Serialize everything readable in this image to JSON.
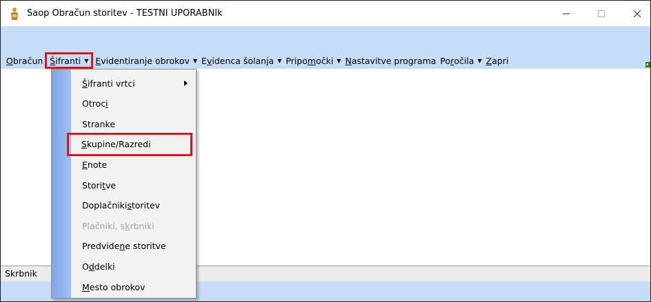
{
  "window": {
    "title": "Saop Obračun storitev - TESTNI UPORABNIk"
  },
  "menubar": {
    "items": [
      {
        "pre": "",
        "ul": "O",
        "post": "bračun",
        "caret": false,
        "active": false
      },
      {
        "pre": "",
        "ul": "Š",
        "post": "ifranti",
        "caret": true,
        "active": true
      },
      {
        "pre": "",
        "ul": "E",
        "post": "videntiranje obrokov",
        "caret": true,
        "active": false
      },
      {
        "pre": "E",
        "ul": "v",
        "post": "idenca šolanja",
        "caret": true,
        "active": false
      },
      {
        "pre": "Pripo",
        "ul": "m",
        "post": "očki",
        "caret": true,
        "active": false
      },
      {
        "pre": "",
        "ul": "N",
        "post": "astavitve programa",
        "caret": false,
        "active": false
      },
      {
        "pre": "Po",
        "ul": "r",
        "post": "očila",
        "caret": true,
        "active": false
      },
      {
        "pre": "",
        "ul": "Z",
        "post": "apri",
        "caret": false,
        "active": false
      }
    ]
  },
  "dropdown": {
    "items": [
      {
        "pre": "",
        "ul": "Š",
        "post": "ifranti vrtci",
        "submenu": true,
        "disabled": false,
        "highlight": false
      },
      {
        "pre": "Otroc",
        "ul": "i",
        "post": "",
        "submenu": false,
        "disabled": false,
        "highlight": false
      },
      {
        "pre": "Stranke",
        "ul": "",
        "post": "",
        "submenu": false,
        "disabled": false,
        "highlight": false
      },
      {
        "pre": "",
        "ul": "S",
        "post": "kupine/Razredi",
        "submenu": false,
        "disabled": false,
        "highlight": true
      },
      {
        "pre": "",
        "ul": "E",
        "post": "note",
        "submenu": false,
        "disabled": false,
        "highlight": false
      },
      {
        "pre": "Stori",
        "ul": "t",
        "post": "ve",
        "submenu": false,
        "disabled": false,
        "highlight": false
      },
      {
        "pre": "Doplačniki ",
        "ul": "s",
        "post": "toritev",
        "submenu": false,
        "disabled": false,
        "highlight": false
      },
      {
        "pre": "Plačniki, s",
        "ul": "k",
        "post": "rbniki",
        "submenu": false,
        "disabled": true,
        "highlight": false
      },
      {
        "pre": "Predvide",
        "ul": "n",
        "post": "e storitve",
        "submenu": false,
        "disabled": false,
        "highlight": false
      },
      {
        "pre": "O",
        "ul": "d",
        "post": "delki",
        "submenu": false,
        "disabled": false,
        "highlight": false
      },
      {
        "pre": "",
        "ul": "M",
        "post": "esto obrokov",
        "submenu": false,
        "disabled": false,
        "highlight": false
      }
    ]
  },
  "statusbar": {
    "text": "Skrbnik"
  },
  "colors": {
    "menubar_bg": "#c6ddf7",
    "highlight_outline": "#d8141c",
    "gutter": "#8fb3ec",
    "disabled_text": "#a4a4a4"
  },
  "icons": {
    "app": "person-app-icon",
    "minimize": "minimize-icon",
    "maximize": "maximize-icon",
    "close": "close-icon",
    "submenu": "submenu-arrow-icon",
    "caret": "dropdown-caret-icon"
  }
}
